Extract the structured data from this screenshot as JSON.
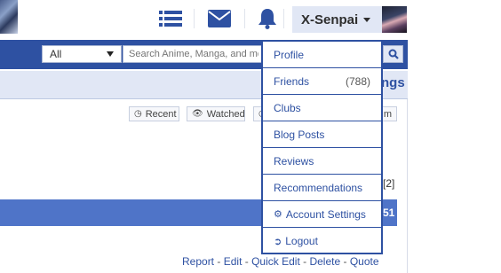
{
  "header": {
    "username": "X-Senpai"
  },
  "searchbar": {
    "category_selected": "All",
    "search_placeholder": "Search Anime, Manga, and more..."
  },
  "subheader": {
    "trailing_text": "ngs"
  },
  "filters": [
    {
      "label": "Recent",
      "icon": "clock-icon"
    },
    {
      "label": "Watched",
      "icon": "eye-icon"
    },
    {
      "label": "",
      "icon": "clock-icon"
    },
    {
      "label": "m",
      "icon": ""
    }
  ],
  "thread": {
    "page_info": "[2]",
    "bar_number": "51",
    "actions": [
      "Report",
      "Edit",
      "Quick Edit",
      "Delete",
      "Quote"
    ]
  },
  "menu": {
    "items": [
      {
        "label": "Profile"
      },
      {
        "label": "Friends",
        "count": "(788)"
      },
      {
        "label": "Clubs"
      },
      {
        "label": "Blog Posts"
      },
      {
        "label": "Reviews"
      },
      {
        "label": "Recommendations"
      },
      {
        "label": "Account Settings",
        "icon": "gear-icon"
      },
      {
        "label": "Logout",
        "icon": "logout-icon"
      }
    ]
  },
  "colors": {
    "brand": "#2e51a2",
    "accent_light": "#e1e7f5",
    "thread_bar": "#4f74c8"
  }
}
